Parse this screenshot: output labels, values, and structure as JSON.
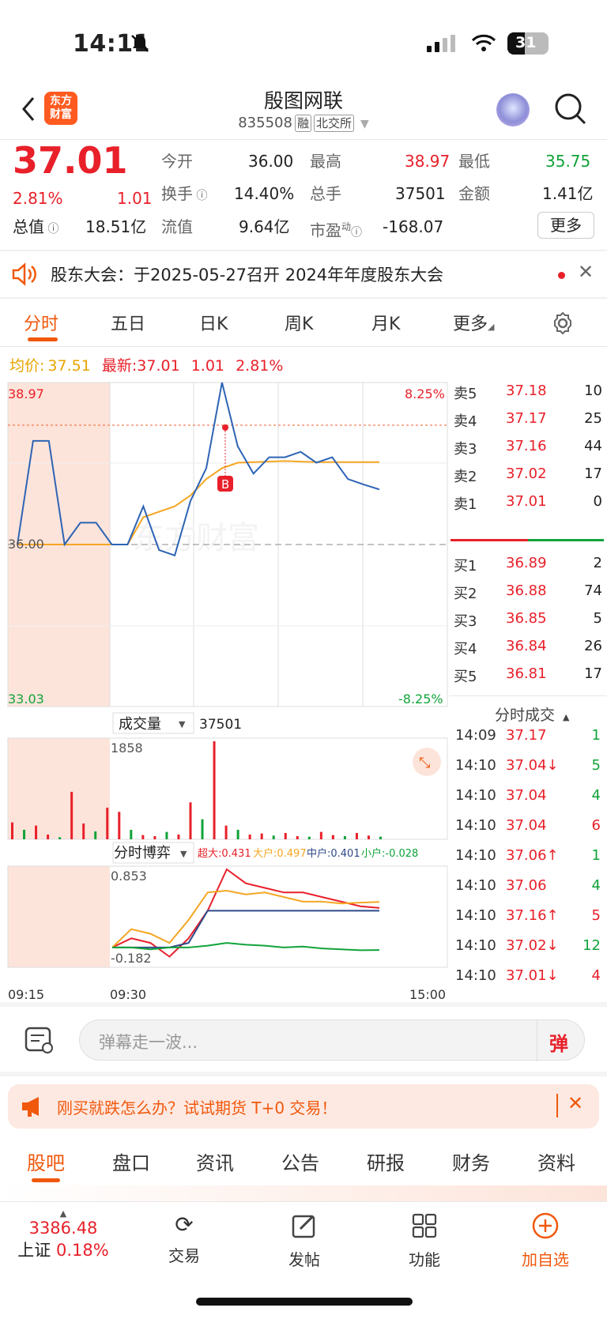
{
  "status": {
    "time": "14:11",
    "battery": "31"
  },
  "header": {
    "back_label": "返回",
    "logo_text_1": "东方",
    "logo_text_2": "财富",
    "title": "殷图网联",
    "code": "835508",
    "tag1": "融",
    "tag2": "北交所"
  },
  "quote": {
    "price": "37.01",
    "pct": "2.81%",
    "change": "1.01",
    "open_label": "今开",
    "open": "36.00",
    "high_label": "最高",
    "high": "38.97",
    "low_label": "最低",
    "low": "35.75",
    "turnover_label": "换手",
    "turnover": "14.40%",
    "volume_label": "总手",
    "volume": "37501",
    "amount_label": "金额",
    "amount": "1.41亿",
    "mcap_label": "总值",
    "mcap": "18.51亿",
    "float_label": "流值",
    "float": "9.64亿",
    "pe_label": "市盈",
    "pe_sup": "动",
    "pe": "-168.07",
    "more_label": "更多"
  },
  "notice": {
    "text": "股东大会：于2025-05-27召开 2024年年度股东大会"
  },
  "chart_tabs": [
    "分时",
    "五日",
    "日K",
    "周K",
    "月K",
    "更多"
  ],
  "priceinfo": {
    "avg_label": "均价:",
    "avg": "37.51",
    "last_label": "最新:",
    "last": "37.01",
    "chg": "1.01",
    "pct": "2.81%"
  },
  "chart_labels": {
    "ymax": "38.97",
    "ymid": "36.00",
    "ymin": "33.03",
    "pmax": "8.25%",
    "pmin": "-8.25%",
    "volume_title": "成交量",
    "volume_total": "37501",
    "volume_max": "1858",
    "fund_title": "分时博弈",
    "fund_super": "超大:0.431",
    "fund_big": "大户:0.497",
    "fund_mid": "中户:0.401",
    "fund_small": "小户:-0.028",
    "fund_max": "0.853",
    "fund_min": "-0.182",
    "t0": "09:15",
    "t1": "09:30",
    "t2": "15:00",
    "marker": "B",
    "watermark": "东方财富"
  },
  "chart_data": [
    {
      "type": "line",
      "title": "分时",
      "x": [
        "09:15",
        "09:30",
        "15:00"
      ],
      "ylim": [
        33.03,
        38.97
      ],
      "prev_close": 36.0,
      "series": [
        {
          "name": "最新",
          "values": [
            36.0,
            37.9,
            37.9,
            36.0,
            36.4,
            36.4,
            36.0,
            36.0,
            36.7,
            35.9,
            35.8,
            36.8,
            37.4,
            38.97,
            37.8,
            37.3,
            37.6,
            37.6,
            37.7,
            37.5,
            37.6,
            37.2,
            37.1,
            37.01
          ]
        },
        {
          "name": "均价",
          "values": [
            36.0,
            36.0,
            36.0,
            36.0,
            36.0,
            36.0,
            36.0,
            36.0,
            36.5,
            36.6,
            36.7,
            36.9,
            37.2,
            37.4,
            37.5,
            37.51,
            37.52,
            37.53,
            37.52,
            37.51,
            37.51,
            37.51,
            37.51,
            37.51
          ]
        }
      ]
    },
    {
      "type": "bar",
      "title": "成交量",
      "ylim": [
        0,
        1858
      ],
      "values": [
        320,
        180,
        260,
        90,
        40,
        900,
        300,
        150,
        600,
        520,
        180,
        80,
        60,
        140,
        90,
        700,
        380,
        1858,
        260,
        180,
        90,
        110,
        70,
        120,
        60,
        50,
        140,
        80,
        60,
        120,
        70,
        50
      ]
    },
    {
      "type": "line",
      "title": "分时博弈",
      "ylim": [
        -0.182,
        0.853
      ],
      "series": [
        {
          "name": "超大",
          "values": [
            0,
            0.1,
            0.05,
            -0.1,
            0.1,
            0.4,
            0.853,
            0.7,
            0.65,
            0.6,
            0.6,
            0.55,
            0.5,
            0.45,
            0.431
          ]
        },
        {
          "name": "大户",
          "values": [
            0,
            0.2,
            0.15,
            0.05,
            0.3,
            0.6,
            0.62,
            0.58,
            0.6,
            0.55,
            0.5,
            0.5,
            0.48,
            0.49,
            0.497
          ]
        },
        {
          "name": "中户",
          "values": [
            0,
            0,
            0,
            0,
            0.05,
            0.401,
            0.401,
            0.401,
            0.401,
            0.401,
            0.401,
            0.401,
            0.401,
            0.401,
            0.401
          ]
        },
        {
          "name": "小户",
          "values": [
            0,
            0,
            -0.02,
            0,
            0,
            0.02,
            0.05,
            0.03,
            0.02,
            0.0,
            0.01,
            -0.01,
            -0.02,
            -0.03,
            -0.028
          ]
        }
      ]
    }
  ],
  "orderbook": {
    "asks": [
      {
        "label": "卖5",
        "price": "37.18",
        "vol": "10"
      },
      {
        "label": "卖4",
        "price": "37.17",
        "vol": "25"
      },
      {
        "label": "卖3",
        "price": "37.16",
        "vol": "44"
      },
      {
        "label": "卖2",
        "price": "37.02",
        "vol": "17"
      },
      {
        "label": "卖1",
        "price": "37.01",
        "vol": "0"
      }
    ],
    "bids": [
      {
        "label": "买1",
        "price": "36.89",
        "vol": "2"
      },
      {
        "label": "买2",
        "price": "36.88",
        "vol": "74"
      },
      {
        "label": "买3",
        "price": "36.85",
        "vol": "5"
      },
      {
        "label": "买4",
        "price": "36.84",
        "vol": "26"
      },
      {
        "label": "买5",
        "price": "36.81",
        "vol": "17"
      }
    ]
  },
  "ticks": {
    "title": "分时成交",
    "rows": [
      {
        "t": "14:09",
        "p": "37.17",
        "v": "1",
        "c": "green"
      },
      {
        "t": "14:10",
        "p": "37.04↓",
        "v": "5",
        "c": "green"
      },
      {
        "t": "14:10",
        "p": "37.04",
        "v": "4",
        "c": "green"
      },
      {
        "t": "14:10",
        "p": "37.04",
        "v": "6",
        "c": "red"
      },
      {
        "t": "14:10",
        "p": "37.06↑",
        "v": "1",
        "c": "green"
      },
      {
        "t": "14:10",
        "p": "37.06",
        "v": "4",
        "c": "green"
      },
      {
        "t": "14:10",
        "p": "37.16↑",
        "v": "5",
        "c": "red"
      },
      {
        "t": "14:10",
        "p": "37.02↓",
        "v": "12",
        "c": "green"
      },
      {
        "t": "14:10",
        "p": "37.01↓",
        "v": "4",
        "c": "red"
      }
    ]
  },
  "danmu": {
    "placeholder": "弹幕走一波...",
    "btn": "弹"
  },
  "banner": {
    "text": "刚买就跌怎么办？试试期货 T+0 交易！"
  },
  "section_tabs": [
    "股吧",
    "盘口",
    "资讯",
    "公告",
    "研报",
    "财务",
    "资料"
  ],
  "bottom": {
    "index_value": "3386.48",
    "index_name": "上证",
    "index_pct": "0.18%",
    "trade": "交易",
    "post": "发帖",
    "func": "功能",
    "add": "加自选"
  },
  "colors": {
    "accent": "#f0580c",
    "up": "#e8202a",
    "down": "#11a33a",
    "avg_line": "#f5a623",
    "price_line": "#2e64b5"
  }
}
